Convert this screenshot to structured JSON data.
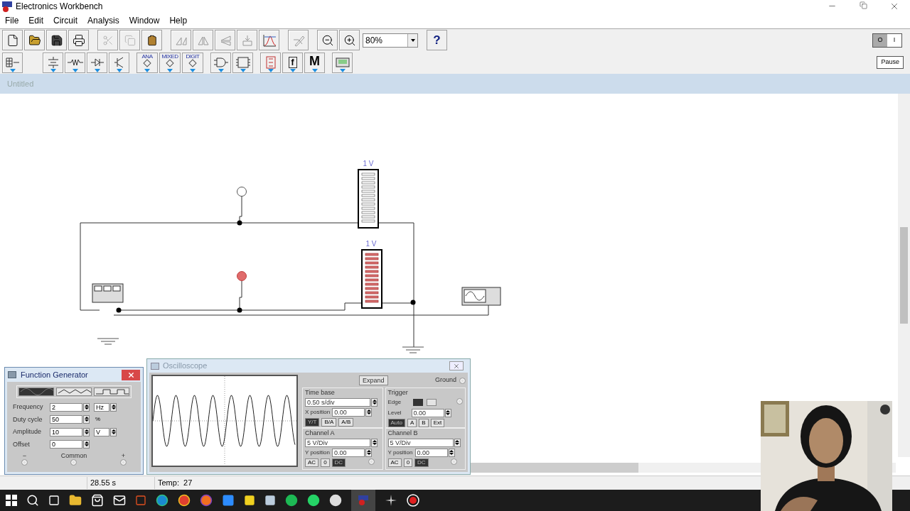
{
  "window": {
    "title": "Electronics Workbench"
  },
  "menu": [
    "File",
    "Edit",
    "Circuit",
    "Analysis",
    "Window",
    "Help"
  ],
  "toolbar": {
    "zoom": "80%",
    "help": "?"
  },
  "parts_bins": [
    {
      "kind": "labeled",
      "label": "ANA"
    },
    {
      "kind": "labeled",
      "label": "MIXED"
    },
    {
      "kind": "labeled",
      "label": "DIGIT"
    },
    {
      "kind": "letter",
      "label": "f"
    },
    {
      "kind": "bold",
      "label": "M"
    }
  ],
  "power": {
    "off_label": "O",
    "on_label": "I",
    "on": false
  },
  "pause": "Pause",
  "document": {
    "title": "Untitled"
  },
  "circuit": {
    "bargraphs": [
      {
        "label": "1 V",
        "lit": false
      },
      {
        "label": "1 V",
        "lit": true
      }
    ],
    "probes": [
      {
        "lit": false
      },
      {
        "lit": true
      }
    ]
  },
  "function_generator": {
    "title": "Function Generator",
    "waveforms": [
      {
        "kind": "sine",
        "selected": true
      },
      {
        "kind": "triangle",
        "selected": false
      },
      {
        "kind": "square",
        "selected": false
      }
    ],
    "fields": [
      {
        "label": "Frequency",
        "value": "2",
        "unit": "Hz",
        "kind": "spin"
      },
      {
        "label": "Duty cycle",
        "value": "50",
        "unit": "%",
        "kind": "text"
      },
      {
        "label": "Amplitude",
        "value": "10",
        "unit": "V",
        "kind": "spin"
      },
      {
        "label": "Offset",
        "value": "0"
      }
    ],
    "terminals": [
      "−",
      "Common",
      "+"
    ]
  },
  "oscilloscope": {
    "title": "Oscilloscope",
    "expand": "Expand",
    "ground": "Ground",
    "time_base": {
      "title": "Time base",
      "value": "0.50 s/div",
      "x_label": "X position",
      "x_value": "0.00",
      "modes": [
        {
          "label": "Y/T",
          "selected": true
        },
        {
          "label": "B/A",
          "selected": false
        },
        {
          "label": "A/B",
          "selected": false
        }
      ]
    },
    "trigger": {
      "title": "Trigger",
      "edge": "Edge",
      "level_label": "Level",
      "level_value": "0.00",
      "sources": [
        {
          "label": "Auto",
          "selected": true
        },
        {
          "label": "A",
          "selected": false
        },
        {
          "label": "B",
          "selected": false
        },
        {
          "label": "Ext",
          "selected": false
        }
      ]
    },
    "channels": [
      {
        "title": "Channel A",
        "scale": "5 V/Div",
        "y_label": "Y position",
        "y_value": "0.00",
        "coupling": [
          {
            "label": "AC",
            "selected": false
          },
          {
            "label": "0",
            "selected": false
          },
          {
            "label": "DC",
            "selected": true
          }
        ]
      },
      {
        "title": "Channel B",
        "scale": "5 V/Div",
        "y_label": "Y position",
        "y_value": "0.00",
        "coupling": [
          {
            "label": "AC",
            "selected": false
          },
          {
            "label": "0",
            "selected": false
          },
          {
            "label": "DC",
            "selected": true
          }
        ]
      }
    ]
  },
  "status_bar": [
    "28.55 s",
    "Temp:  27"
  ],
  "webcam": {
    "kind": "picture"
  }
}
